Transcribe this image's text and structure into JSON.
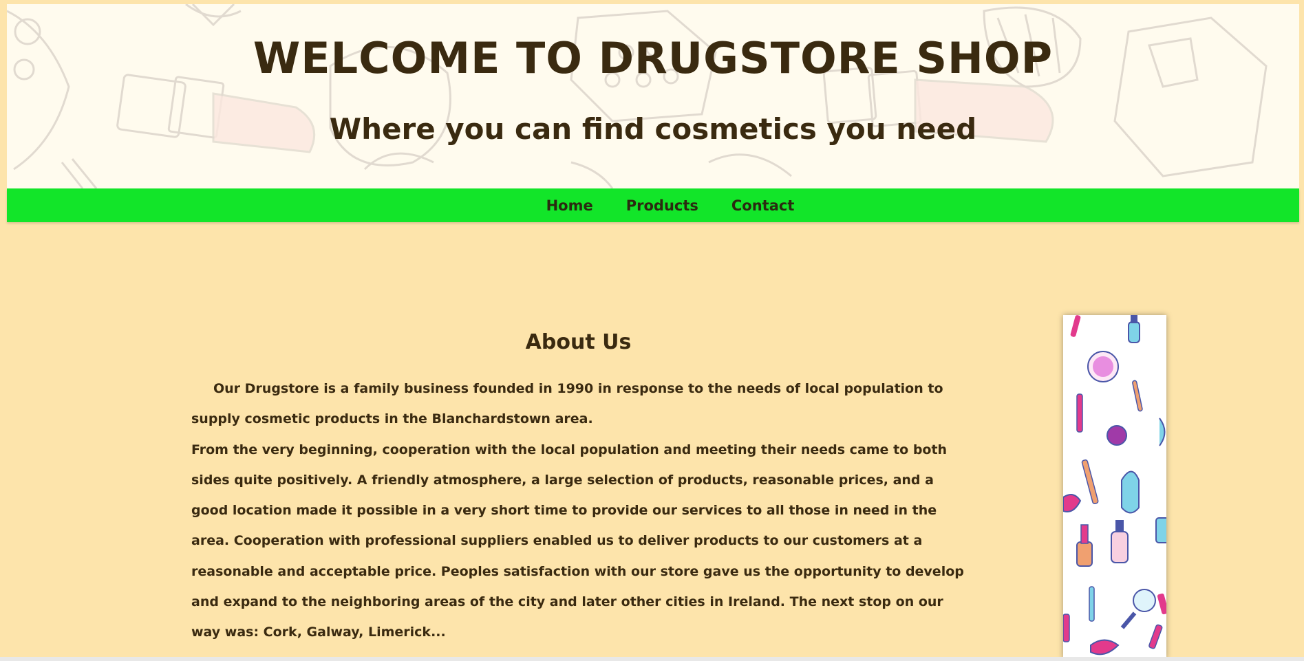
{
  "header": {
    "title": "WELCOME TO DRUGSTORE SHOP",
    "subtitle": "Where you can find cosmetics you need"
  },
  "nav": {
    "items": [
      "Home",
      "Products",
      "Contact"
    ]
  },
  "about": {
    "title": "About Us",
    "paragraph1": "Our Drugstore is a family business founded in 1990 in response to the needs of local population to supply cosmetic products in the Blanchardstown area.",
    "paragraph2": "From the very beginning, cooperation with the local population and meeting their needs came to both sides quite positively. A friendly atmosphere, a large selection of products, reasonable prices, and a good location made it possible in a very short time to provide our services to all those in need in the area. Cooperation with professional suppliers enabled us to deliver products to our customers at a reasonable and acceptable price. Peoples satisfaction with our store gave us the opportunity to develop and expand to the neighboring areas of the city and later other cities in Ireland. The next stop on our way was: Cork, Galway, Limerick..."
  },
  "colors": {
    "background": "#fde4ab",
    "navbar": "#12e529",
    "text": "#3a2a10",
    "header_bg": "#fffbee"
  },
  "icons": {
    "header_pattern": "cosmetics-pattern-icon",
    "side_banner": "cosmetics-illustration-icon"
  }
}
